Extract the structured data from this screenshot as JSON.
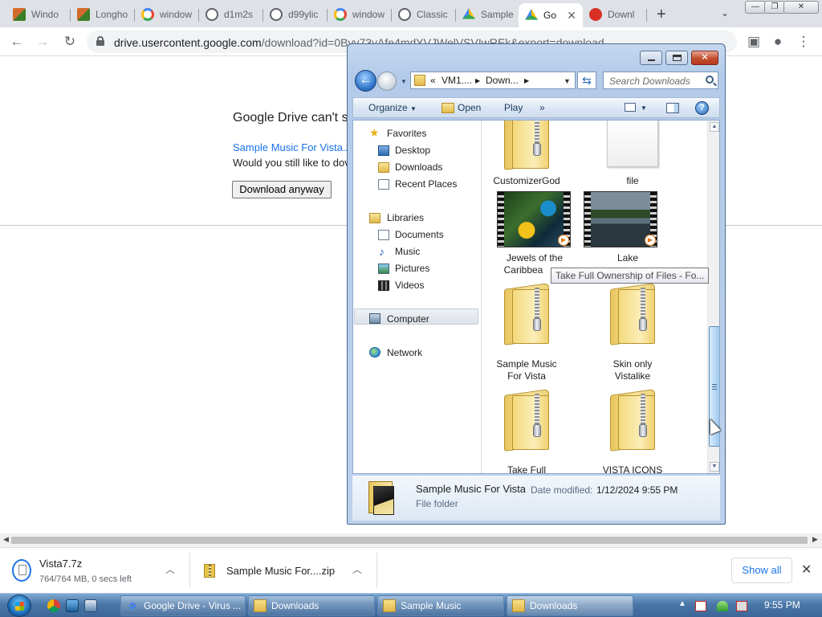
{
  "browser": {
    "tabs": [
      {
        "label": "Windo",
        "icon": "image-favicon"
      },
      {
        "label": "Longho",
        "icon": "image-favicon"
      },
      {
        "label": "window",
        "icon": "google-g-favicon"
      },
      {
        "label": "d1m2s",
        "icon": "globe-favicon"
      },
      {
        "label": "d99ylic",
        "icon": "globe-favicon"
      },
      {
        "label": "window",
        "icon": "google-g-favicon"
      },
      {
        "label": "Classic",
        "icon": "globe-favicon"
      },
      {
        "label": "Sample",
        "icon": "google-drive-favicon"
      },
      {
        "label": "Go",
        "icon": "google-drive-favicon",
        "active": true
      },
      {
        "label": "Downl",
        "icon": "gmail-favicon"
      }
    ],
    "new_tab": "+",
    "url_main": "drive.usercontent.google.com",
    "url_rest": "/download?id=0Byv73yAfe4mdYVJWelVSVIwREk&export=download"
  },
  "page": {
    "title": "Google Drive can't s",
    "file_link": "Sample Music For Vista.z",
    "question": "Would you still like to dov",
    "download_button": "Download anyway"
  },
  "downloads_shelf": {
    "items": [
      {
        "name": "Vista7.7z",
        "status": "764/764 MB, 0 secs left"
      },
      {
        "name": "Sample Music For....zip"
      }
    ],
    "show_all": "Show all"
  },
  "explorer": {
    "breadcrumbs": [
      "VM1....",
      "Down..."
    ],
    "breadcrumb_prefix": "«",
    "search_placeholder": "Search Downloads",
    "commands": {
      "organize": "Organize",
      "open": "Open",
      "play": "Play",
      "more": "»"
    },
    "nav": {
      "favorites": "Favorites",
      "desktop": "Desktop",
      "downloads": "Downloads",
      "recent": "Recent Places",
      "libraries": "Libraries",
      "documents": "Documents",
      "music": "Music",
      "pictures": "Pictures",
      "videos": "Videos",
      "computer": "Computer",
      "network": "Network"
    },
    "files": [
      {
        "name": "CustomizerGod",
        "type": "zip-folder"
      },
      {
        "name": "file",
        "type": "blank-file"
      },
      {
        "name": "Jewels of the",
        "name2": "Caribbea",
        "type": "video"
      },
      {
        "name": "Lake",
        "type": "video"
      },
      {
        "name": "Sample Music",
        "name2": "For Vista",
        "type": "zip-folder"
      },
      {
        "name": "Skin only",
        "name2": "Vistalike",
        "type": "zip-folder"
      },
      {
        "name": "Take Full",
        "type": "zip-folder"
      },
      {
        "name": "VISTA ICONS",
        "type": "zip-folder"
      }
    ],
    "tooltip": "Take Full Ownership of Files - Fo...",
    "details": {
      "name": "Sample Music For Vista",
      "date_label": "Date modified:",
      "date_value": "1/12/2024 9:55 PM",
      "type": "File folder"
    }
  },
  "taskbar": {
    "tasks": [
      {
        "label": "Google Drive - Virus ...",
        "icon": "chrome-icon"
      },
      {
        "label": "Downloads",
        "icon": "folder-icon"
      },
      {
        "label": "Sample Music",
        "icon": "folder-icon"
      },
      {
        "label": "Downloads",
        "icon": "folder-icon",
        "active": true
      }
    ],
    "clock": "9:55 PM"
  }
}
